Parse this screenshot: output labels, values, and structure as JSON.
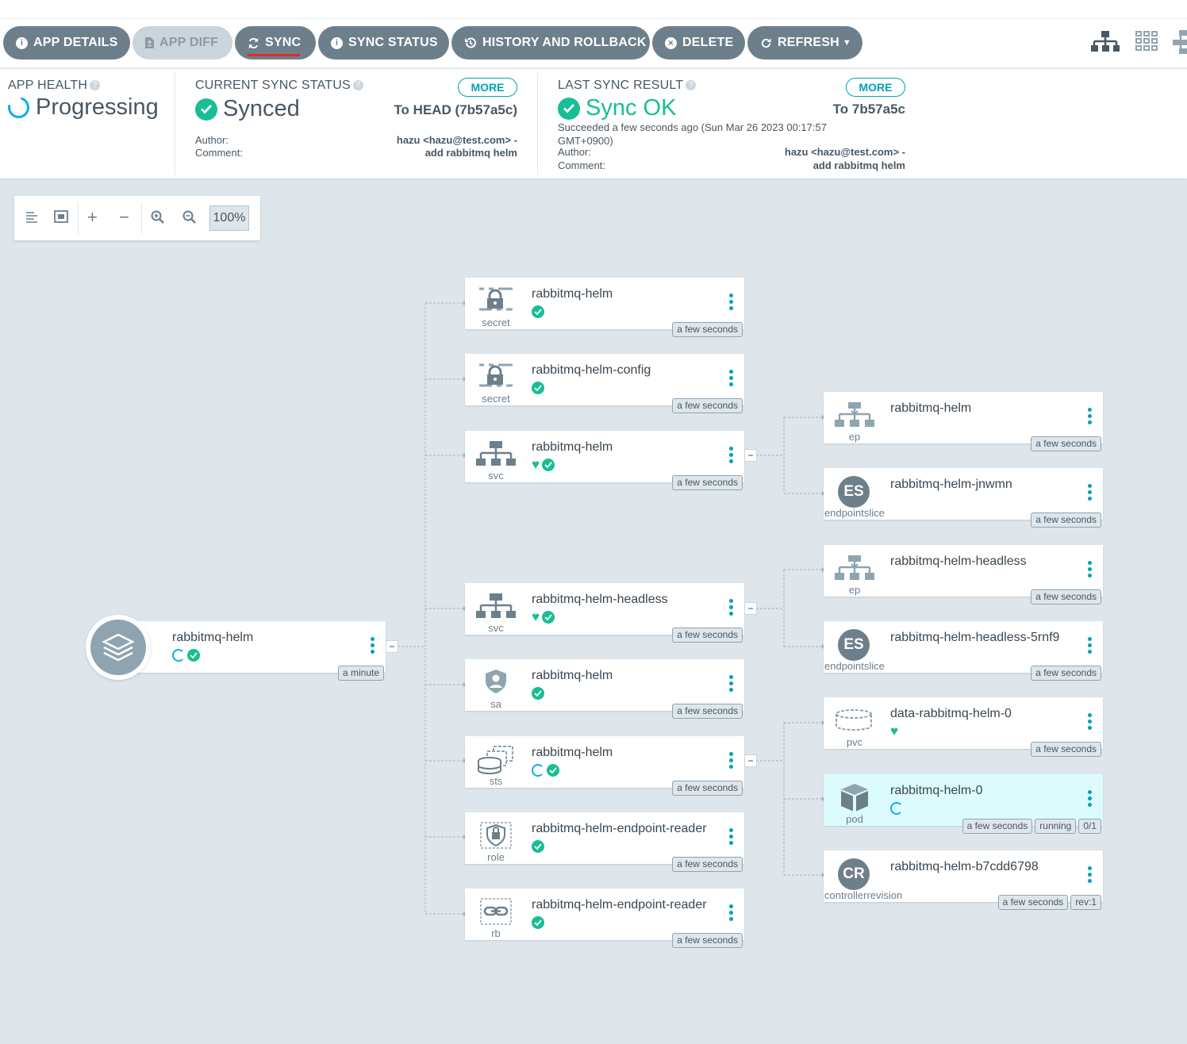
{
  "toolbar": {
    "app_details": "APP DETAILS",
    "app_diff": "APP DIFF",
    "sync": "SYNC",
    "sync_status": "SYNC STATUS",
    "history": "HISTORY AND ROLLBACK",
    "delete": "DELETE",
    "refresh": "REFRESH"
  },
  "health": {
    "label": "APP HEALTH",
    "value": "Progressing"
  },
  "current_sync": {
    "label": "CURRENT SYNC STATUS",
    "value": "Synced",
    "more": "MORE",
    "target": "To HEAD (7b57a5c)",
    "author_label": "Author:",
    "comment_label": "Comment:",
    "author": "hazu <hazu@test.com> -",
    "comment": "add rabbitmq helm"
  },
  "last_sync": {
    "label": "LAST SYNC RESULT",
    "value": "Sync OK",
    "more": "MORE",
    "target": "To 7b57a5c",
    "succeeded": "Succeeded a few seconds ago (Sun Mar 26 2023 00:17:57",
    "tz": "GMT+0900)",
    "author_label": "Author:",
    "comment_label": "Comment:",
    "author": "hazu <hazu@test.com> -",
    "comment": "add rabbitmq helm"
  },
  "zoom": {
    "value": "100%"
  },
  "app_node": {
    "name": "rabbitmq-helm",
    "age": "a minute"
  },
  "nodes": [
    {
      "name": "rabbitmq-helm",
      "kind": "secret",
      "age": "a few seconds"
    },
    {
      "name": "rabbitmq-helm-config",
      "kind": "secret",
      "age": "a few seconds"
    },
    {
      "name": "rabbitmq-helm",
      "kind": "svc",
      "age": "a few seconds"
    },
    {
      "name": "rabbitmq-helm-headless",
      "kind": "svc",
      "age": "a few seconds"
    },
    {
      "name": "rabbitmq-helm",
      "kind": "sa",
      "age": "a few seconds"
    },
    {
      "name": "rabbitmq-helm",
      "kind": "sts",
      "age": "a few seconds"
    },
    {
      "name": "rabbitmq-helm-endpoint-reader",
      "kind": "role",
      "age": "a few seconds"
    },
    {
      "name": "rabbitmq-helm-endpoint-reader",
      "kind": "rb",
      "age": "a few seconds"
    },
    {
      "name": "rabbitmq-helm",
      "kind": "ep",
      "age": "a few seconds"
    },
    {
      "name": "rabbitmq-helm-jnwmn",
      "kind": "endpointslice",
      "abbr": "ES",
      "age": "a few seconds"
    },
    {
      "name": "rabbitmq-helm-headless",
      "kind": "ep",
      "age": "a few seconds"
    },
    {
      "name": "rabbitmq-helm-headless-5rnf9",
      "kind": "endpointslice",
      "abbr": "ES",
      "age": "a few seconds"
    },
    {
      "name": "data-rabbitmq-helm-0",
      "kind": "pvc",
      "age": "a few seconds"
    },
    {
      "name": "rabbitmq-helm-0",
      "kind": "pod",
      "age": "a few seconds",
      "status": "running",
      "ready": "0/1"
    },
    {
      "name": "rabbitmq-helm-b7cdd6798",
      "kind": "controllerrevision",
      "abbr": "CR",
      "age": "a few seconds",
      "rev": "rev:1"
    }
  ],
  "colors": {
    "accent": "#00a2b3",
    "ok": "#18be94",
    "progress": "#0dadea",
    "button": "#6d7f8b",
    "canvas": "#dee6eb",
    "sync_underline": "#e02b2b"
  }
}
